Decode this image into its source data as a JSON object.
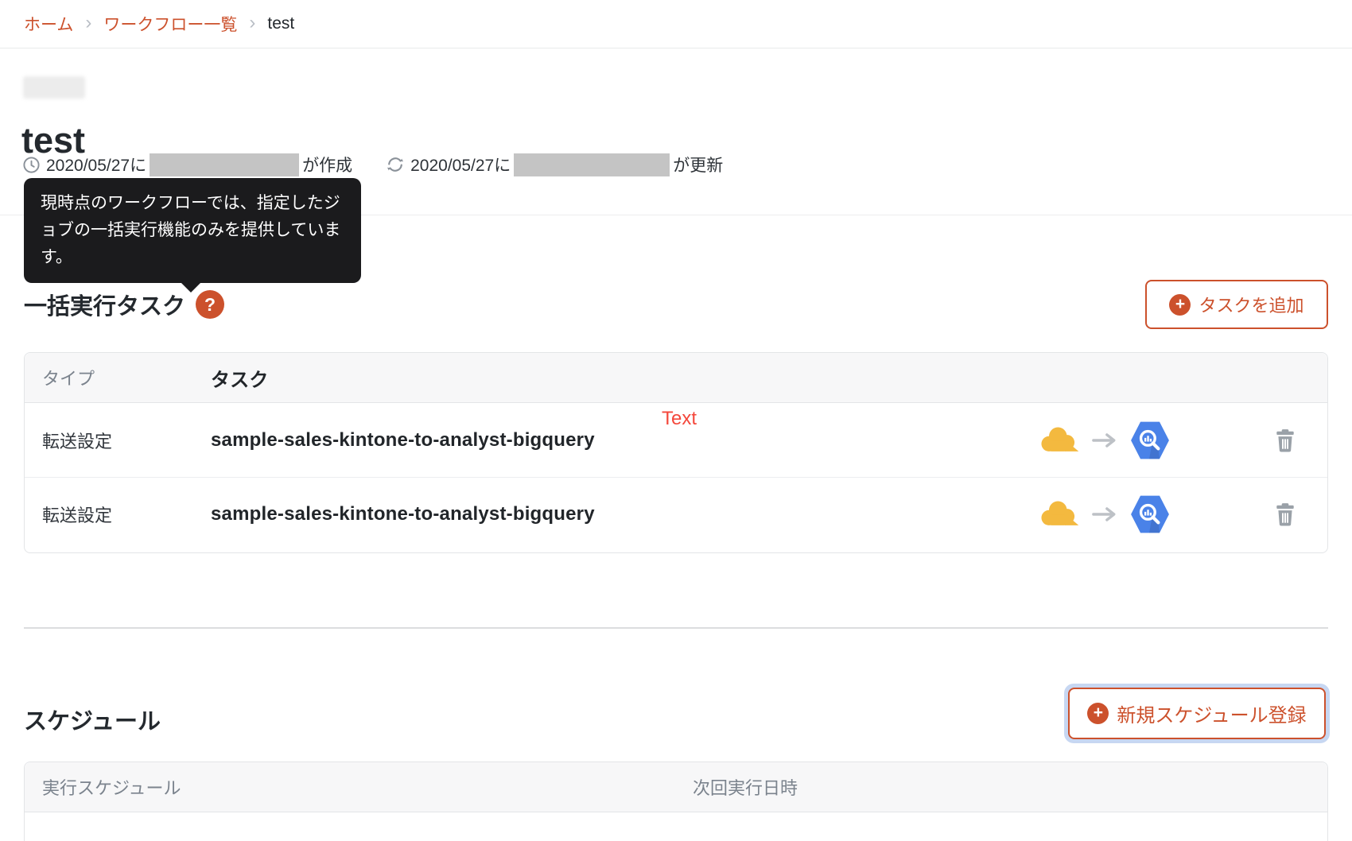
{
  "breadcrumb": {
    "separator": "›",
    "items": [
      {
        "label": "ホーム"
      },
      {
        "label": "ワークフロー一覧"
      },
      {
        "label": "test"
      }
    ]
  },
  "header": {
    "title": "test",
    "created_prefix": "2020/05/27に",
    "created_suffix": "が作成",
    "updated_prefix": "2020/05/27に",
    "updated_suffix": "が更新"
  },
  "tooltip": {
    "text": "現時点のワークフローでは、指定したジョブの一括実行機能のみを提供しています。"
  },
  "tasks": {
    "heading": "一括実行タスク",
    "help_glyph": "?",
    "plus": "+",
    "add_button": "タスクを追加",
    "annotation": "Text",
    "columns": {
      "type": "タイプ",
      "task": "タスク"
    },
    "rows": [
      {
        "type": "転送設定",
        "task": "sample-sales-kintone-to-analyst-bigquery",
        "source_icon": "kintone-logo",
        "destination_icon": "bigquery-logo"
      },
      {
        "type": "転送設定",
        "task": "sample-sales-kintone-to-analyst-bigquery",
        "source_icon": "kintone-logo",
        "destination_icon": "bigquery-logo"
      }
    ]
  },
  "schedule": {
    "heading": "スケジュール",
    "plus": "+",
    "add_button": "新規スケジュール登録",
    "columns": {
      "schedule": "実行スケジュール",
      "next_run": "次回実行日時"
    }
  },
  "colors": {
    "accent": "#cc512c",
    "annotation_red": "#f4473b",
    "kintone_yellow": "#f3b93f",
    "bigquery_blue": "#4a82e8",
    "tooltip_bg": "#1b1b1d"
  }
}
